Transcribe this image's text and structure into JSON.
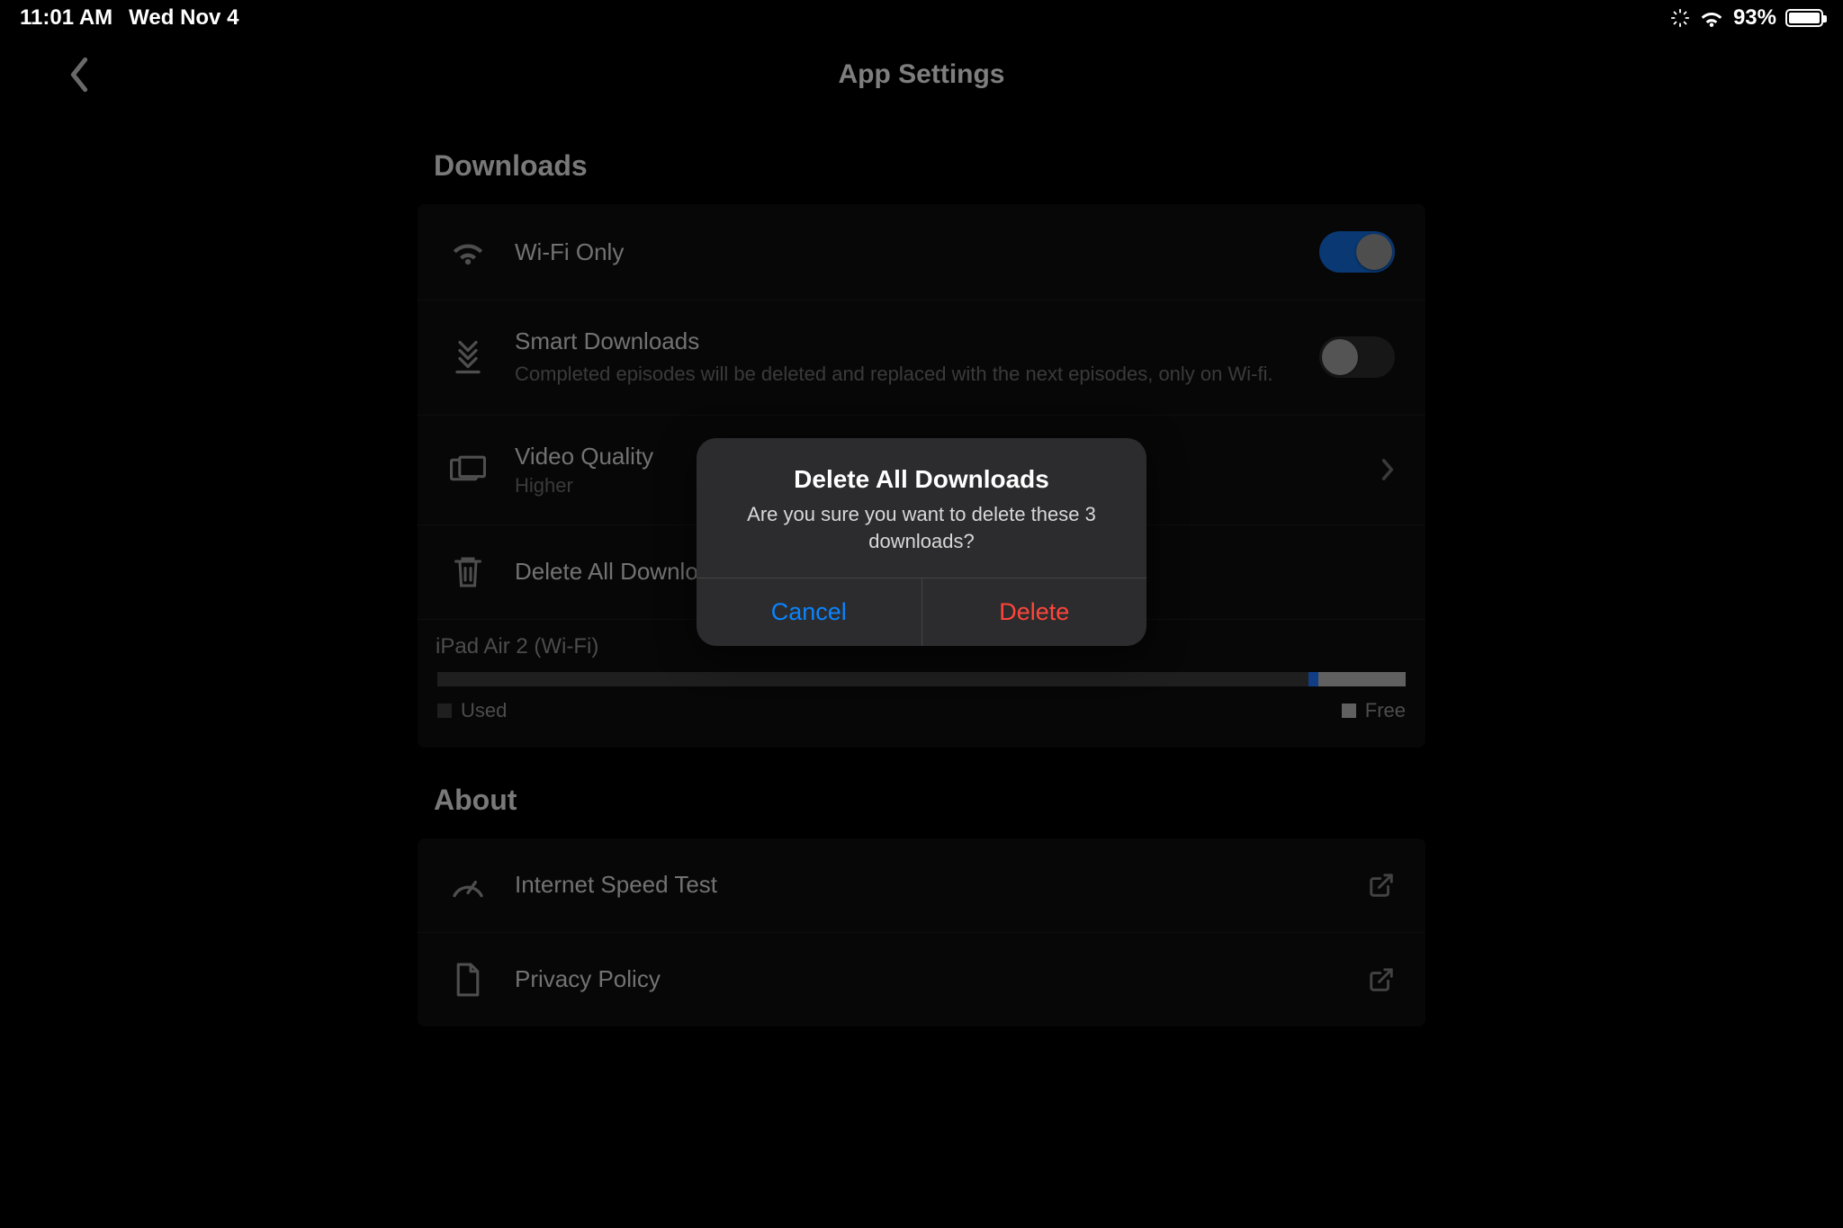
{
  "status": {
    "time": "11:01 AM",
    "date": "Wed Nov 4",
    "battery_pct": "93%"
  },
  "nav": {
    "title": "App Settings"
  },
  "sections": {
    "downloads_title": "Downloads",
    "about_title": "About"
  },
  "downloads": {
    "wifi_only": {
      "label": "Wi-Fi Only",
      "on": true
    },
    "smart": {
      "label": "Smart Downloads",
      "sub": "Completed episodes will be deleted and replaced with the next episodes, only on Wi-fi.",
      "on": false
    },
    "quality": {
      "label": "Video Quality",
      "value": "Higher"
    },
    "delete_all": {
      "label": "Delete All Downloads"
    }
  },
  "storage": {
    "device": "iPad Air 2 (Wi-Fi)",
    "used_label": "Used",
    "free_label": "Free",
    "used_pct": 90,
    "app_pct": 1,
    "free_pct": 9
  },
  "about": {
    "speed_test": "Internet Speed Test",
    "privacy": "Privacy Policy"
  },
  "alert": {
    "title": "Delete All Downloads",
    "message": "Are you sure you want to delete these 3 downloads?",
    "cancel": "Cancel",
    "delete": "Delete"
  }
}
